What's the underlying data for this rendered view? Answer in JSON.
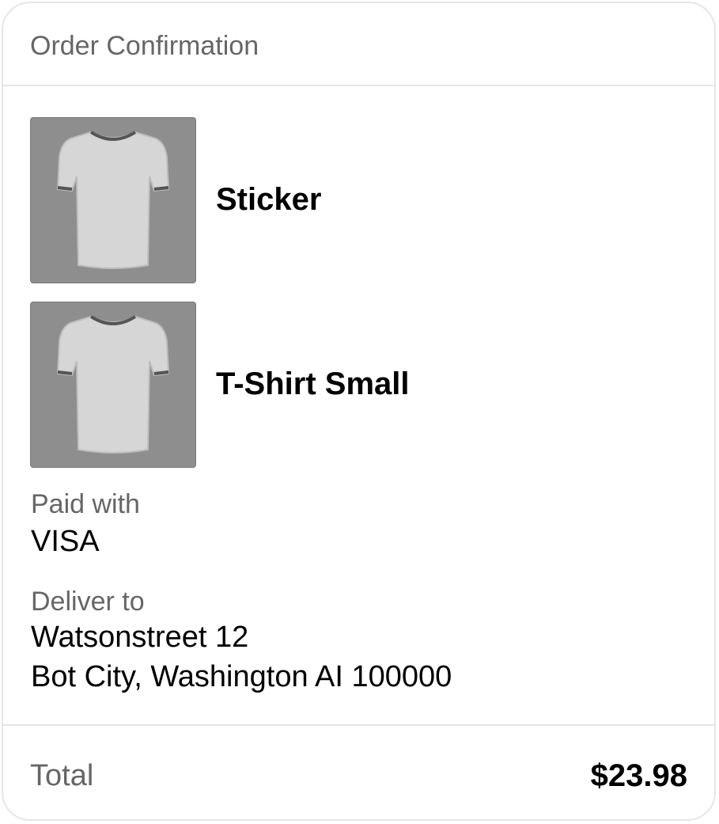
{
  "header": {
    "title": "Order Confirmation"
  },
  "items": [
    {
      "name": "Sticker",
      "image_icon": "t-shirt-icon"
    },
    {
      "name": "T-Shirt Small",
      "image_icon": "t-shirt-icon"
    }
  ],
  "payment": {
    "label": "Paid with",
    "value": "VISA"
  },
  "delivery": {
    "label": "Deliver to",
    "line1": "Watsonstreet 12",
    "line2": "Bot City, Washington AI 100000"
  },
  "footer": {
    "total_label": "Total",
    "total_value": "$23.98"
  },
  "colors": {
    "divider": "#e6e6e6",
    "muted_text": "#666666",
    "thumbnail_bg": "#8e8e8e"
  }
}
